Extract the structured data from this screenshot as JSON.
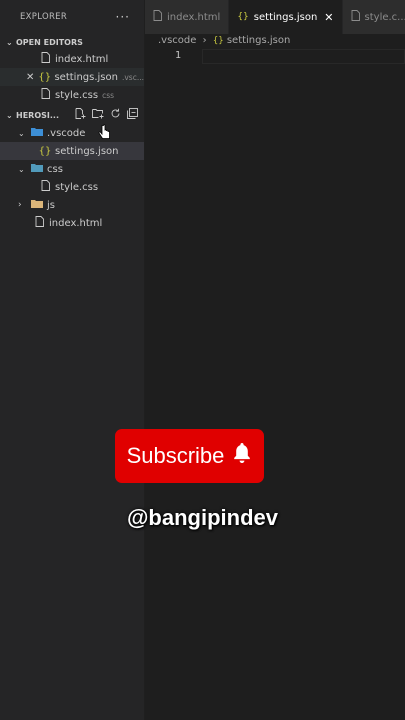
{
  "explorer": {
    "title": "EXPLORER",
    "more": "···",
    "open_editors_title": "OPEN EDITORS",
    "open_editors": [
      {
        "name": "index.html",
        "suffix": ""
      },
      {
        "name": "settings.json",
        "suffix": ".vsc..."
      },
      {
        "name": "style.css",
        "suffix": "css"
      }
    ],
    "project_title": "HEROSI...",
    "tree": [
      {
        "name": ".vscode"
      },
      {
        "name": "settings.json"
      },
      {
        "name": "css"
      },
      {
        "name": "style.css"
      },
      {
        "name": "js"
      },
      {
        "name": "index.html"
      }
    ]
  },
  "tabs": [
    {
      "label": "index.html"
    },
    {
      "label": "settings.json"
    },
    {
      "label": "style.c..."
    }
  ],
  "breadcrumb": {
    "folder": ".vscode",
    "file": "settings.json"
  },
  "editor": {
    "line_number": "1"
  },
  "overlay": {
    "subscribe": "Subscribe",
    "handle": "@bangipindev"
  },
  "colors": {
    "accent": "#e00000",
    "json_icon": "#cbcb41",
    "html_icon": "#e37933",
    "css_icon": "#519aba",
    "folder_icon": "#dcb67a"
  }
}
